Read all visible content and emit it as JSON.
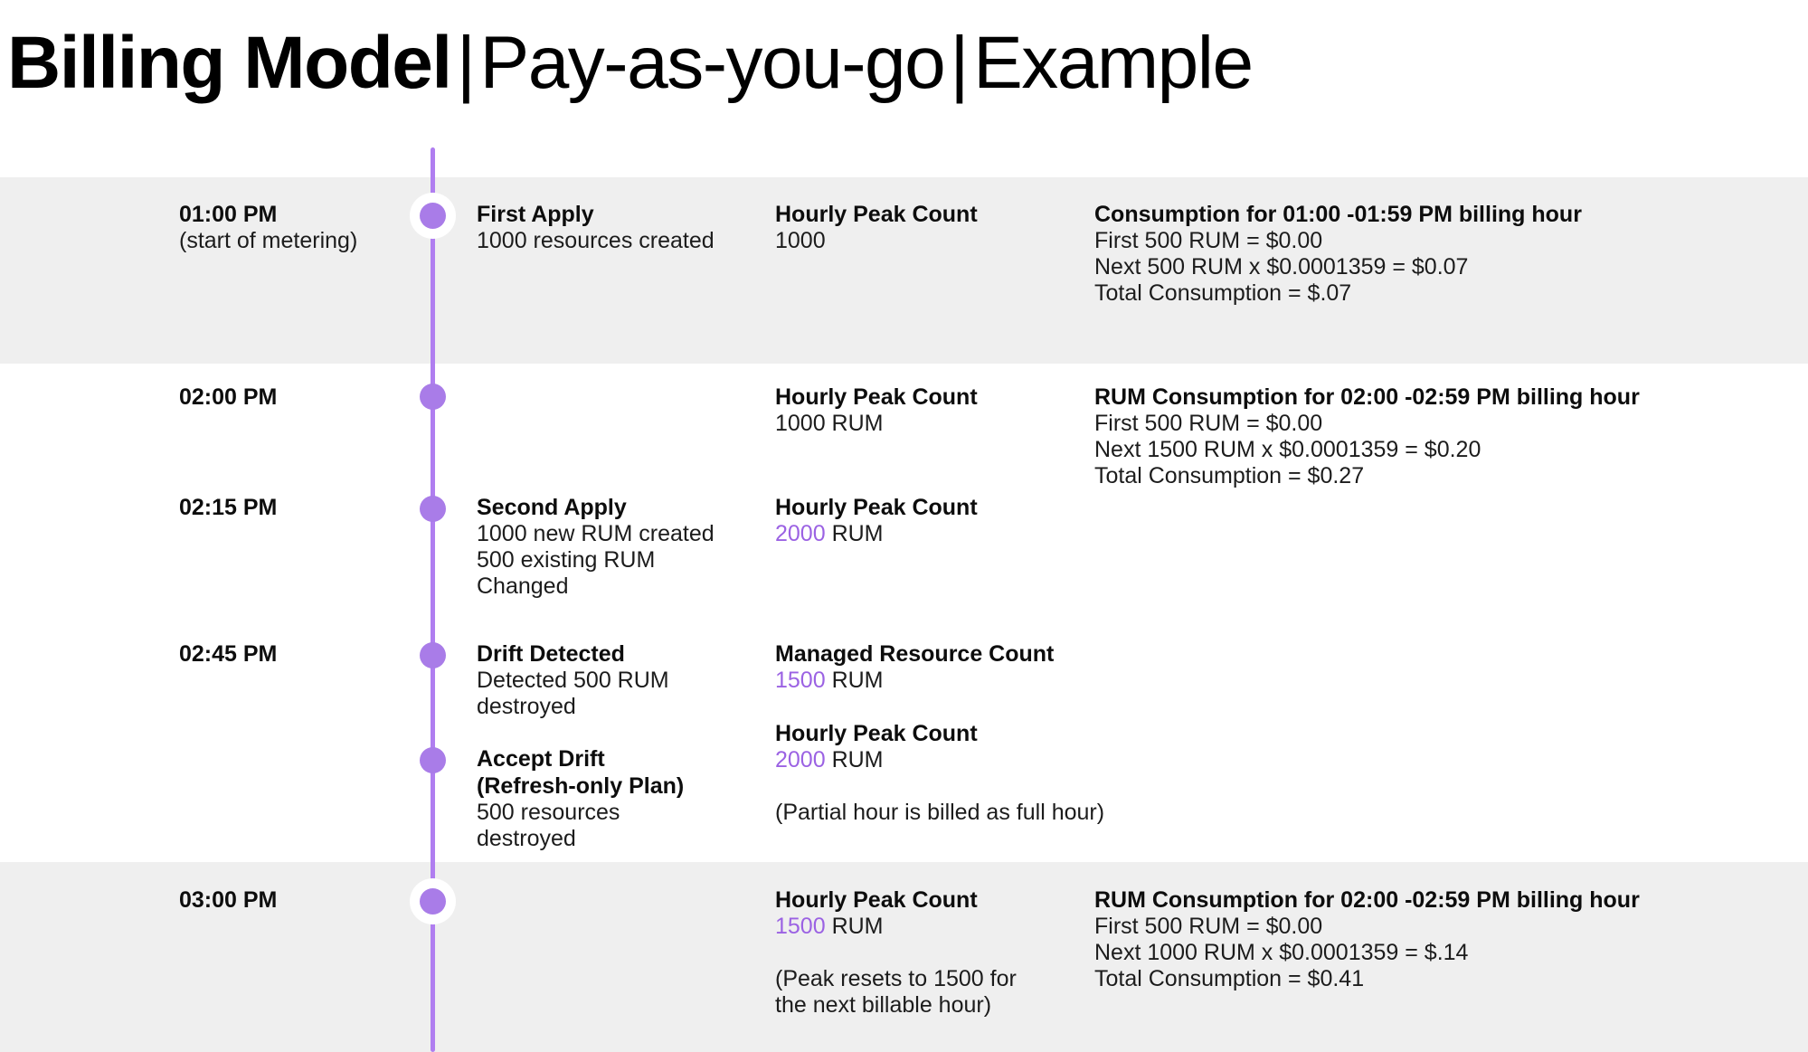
{
  "title": {
    "strong": "Billing Model",
    "separator1": "|",
    "light1": "Pay-as-you-go",
    "separator2": "|",
    "light2": "Example"
  },
  "colors": {
    "accent_purple": "#a97ce8",
    "axis_purple": "#b07ef0",
    "highlight_text": "#9b62e3",
    "band_gray": "#efefef",
    "page_background": "#ffffff",
    "text": "#111111"
  },
  "timeline": {
    "rows": [
      {
        "id": "row-0100pm",
        "banded": true,
        "dot": true,
        "dot_halo": true,
        "time": "01:00 PM",
        "time_note": "(start of metering)",
        "activity_title": "First Apply",
        "activity_lines": [
          "1000 resources created"
        ],
        "count_blocks": [
          {
            "label": "Hourly Peak Count",
            "value_highlight": "",
            "value_rest": "1000"
          }
        ],
        "count_note": "",
        "consumption_title": "Consumption for 01:00 -01:59 PM billing hour",
        "consumption_lines": [
          "First 500 RUM =  $0.00",
          "Next 500 RUM x $0.0001359 = $0.07",
          "Total Consumption = $.07"
        ]
      },
      {
        "id": "row-0200pm",
        "banded": false,
        "dot": true,
        "dot_halo": false,
        "time": "02:00 PM",
        "time_note": "",
        "activity_title": "",
        "activity_lines": [],
        "count_blocks": [
          {
            "label": "Hourly Peak Count",
            "value_highlight": "",
            "value_rest": "1000 RUM"
          }
        ],
        "count_note": "",
        "consumption_title": "RUM Consumption for 02:00 -02:59 PM billing hour",
        "consumption_lines": [
          "First 500 RUM = $0.00",
          "Next 1500 RUM x $0.0001359  = $0.20",
          "Total Consumption = $0.27"
        ]
      },
      {
        "id": "row-0215pm",
        "banded": false,
        "dot": true,
        "dot_halo": false,
        "time": "02:15 PM",
        "time_note": "",
        "activity_title": "Second Apply",
        "activity_lines": [
          "1000 new RUM created",
          "500 existing RUM",
          "Changed"
        ],
        "count_blocks": [
          {
            "label": "Hourly Peak Count",
            "value_highlight": "2000",
            "value_rest": " RUM"
          }
        ],
        "count_note": "",
        "consumption_title": "",
        "consumption_lines": []
      },
      {
        "id": "row-0245pm",
        "banded": false,
        "dot": true,
        "dot_halo": false,
        "time": "02:45 PM",
        "time_note": "",
        "activity_title": "Drift Detected",
        "activity_lines": [
          "Detected 500 RUM",
          "destroyed"
        ],
        "count_blocks": [
          {
            "label": "Managed Resource Count",
            "value_highlight": "1500",
            "value_rest": " RUM"
          },
          {
            "label": "Hourly Peak Count",
            "value_highlight": "2000",
            "value_rest": " RUM"
          }
        ],
        "count_note": "(Partial hour is billed as full hour)",
        "consumption_title": "",
        "consumption_lines": []
      },
      {
        "id": "row-accept-drift",
        "banded": false,
        "dot": true,
        "dot_halo": false,
        "time": "",
        "time_note": "",
        "activity_title": "Accept Drift",
        "activity_title2": "(Refresh-only Plan)",
        "activity_lines": [
          "500 resources",
          "destroyed"
        ],
        "count_blocks": [],
        "count_note": "",
        "consumption_title": "",
        "consumption_lines": []
      },
      {
        "id": "row-0300pm",
        "banded": true,
        "dot": true,
        "dot_halo": true,
        "time": "03:00 PM",
        "time_note": "",
        "activity_title": "",
        "activity_lines": [],
        "count_blocks": [
          {
            "label": "Hourly Peak Count",
            "value_highlight": "1500",
            "value_rest": " RUM"
          }
        ],
        "count_note_lines": [
          "(Peak resets to 1500 for",
          "the next billable hour)"
        ],
        "consumption_title": "RUM Consumption for 02:00 -02:59 PM billing hour",
        "consumption_lines": [
          "First 500 RUM = $0.00",
          "Next 1000 RUM x $0.0001359  = $.14",
          "Total Consumption = $0.41"
        ]
      }
    ]
  }
}
